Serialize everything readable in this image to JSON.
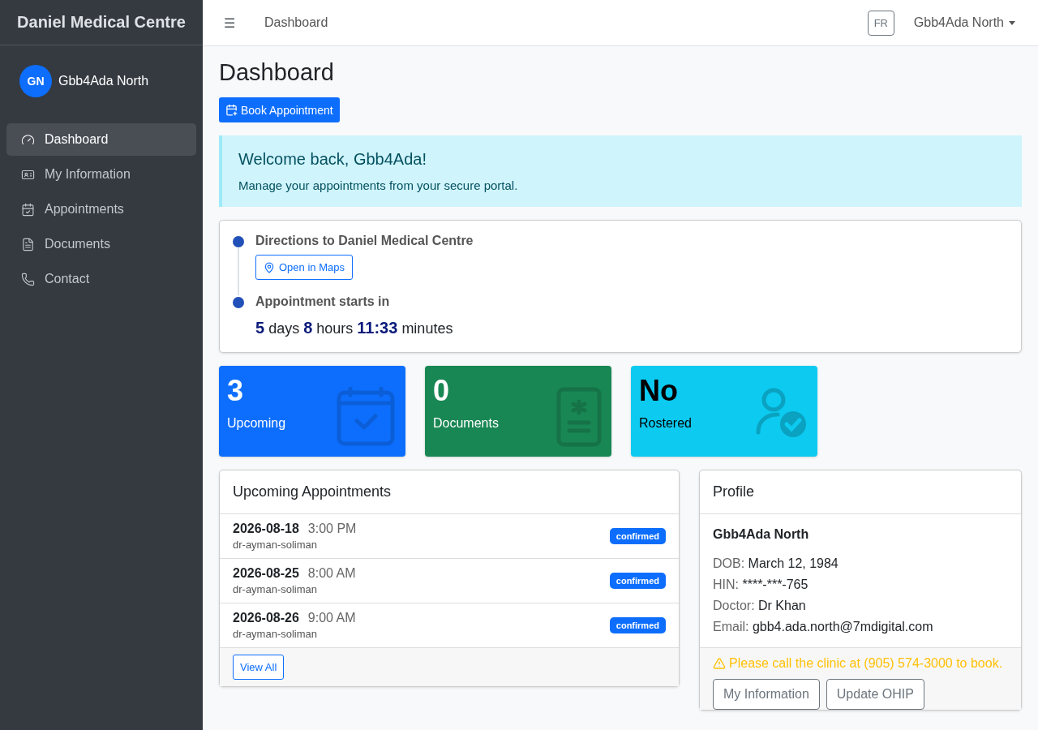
{
  "sidebar": {
    "brand": "Daniel Medical Centre",
    "user": {
      "initials": "GN",
      "name": "Gbb4Ada North"
    },
    "items": [
      {
        "label": "Dashboard",
        "kind": "gauge",
        "selected": true
      },
      {
        "label": "My Information",
        "kind": "card",
        "selected": false
      },
      {
        "label": "Appointments",
        "kind": "calendar",
        "selected": false
      },
      {
        "label": "Documents",
        "kind": "document",
        "selected": false
      },
      {
        "label": "Contact",
        "kind": "phone",
        "selected": false
      }
    ]
  },
  "topbar": {
    "menu_glyph": "☰",
    "title": "Dashboard",
    "language": "FR",
    "user": "Gbb4Ada North"
  },
  "page": {
    "title": "Dashboard",
    "book_button": "Book Appointment"
  },
  "alert": {
    "heading": "Welcome back, Gbb4Ada!",
    "text": "Manage your appointments from your secure portal."
  },
  "timeline": [
    {
      "kind": "link",
      "title": "Directions to Daniel Medical Centre",
      "button": "Open in Maps"
    },
    {
      "kind": "countdown",
      "title": "Appointment starts in",
      "parts": [
        {
          "value": "5",
          "unit": "days"
        },
        {
          "value": "8",
          "unit": "hours"
        },
        {
          "value": "11:33",
          "unit": "minutes"
        }
      ]
    }
  ],
  "stats": [
    {
      "value": "3",
      "label": "Upcoming",
      "kind": "calendar",
      "color": "#0d6efd"
    },
    {
      "value": "0",
      "label": "Documents",
      "kind": "document",
      "color": "#198754"
    },
    {
      "value": "No",
      "label": "Rostered",
      "kind": "person",
      "color": "#0dcaf0"
    }
  ],
  "appointments": {
    "title": "Upcoming Appointments",
    "rows": [
      {
        "date": "2026-08-18",
        "time": "3:00 PM",
        "doctor": "dr-ayman-soliman",
        "status": "confirmed"
      },
      {
        "date": "2026-08-25",
        "time": "8:00 AM",
        "doctor": "dr-ayman-soliman",
        "status": "confirmed"
      },
      {
        "date": "2026-08-26",
        "time": "9:00 AM",
        "doctor": "dr-ayman-soliman",
        "status": "confirmed"
      }
    ],
    "view_all": "View All"
  },
  "profile": {
    "title": "Profile",
    "name": "Gbb4Ada North",
    "fields": [
      {
        "label": "DOB:",
        "value": "March 12, 1984"
      },
      {
        "label": "HIN:",
        "value": "****-***-765"
      },
      {
        "label": "Doctor:",
        "value": "Dr Khan"
      },
      {
        "label": "Email:",
        "value": "gbb4.ada.north@7mdigital.com"
      }
    ],
    "warning": "Please call the clinic at (905) 574-3000 to book.",
    "buttons": [
      "My Information",
      "Update OHIP"
    ]
  }
}
